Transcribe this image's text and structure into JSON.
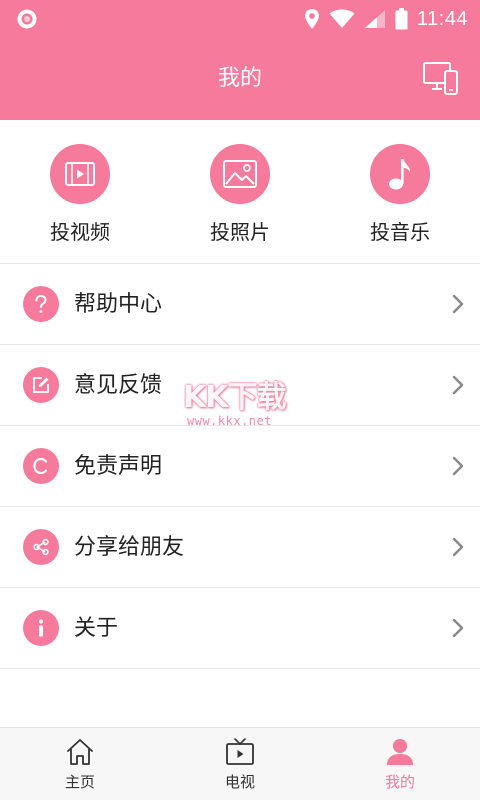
{
  "status_bar": {
    "time": "11:44",
    "icons": [
      "notification-circle-icon",
      "location-icon",
      "wifi-icon",
      "signal-icon",
      "battery-icon"
    ]
  },
  "header": {
    "title": "我的",
    "right_icon": "cast-screen-icon"
  },
  "quick_actions": [
    {
      "label": "投视频",
      "icon": "video-icon"
    },
    {
      "label": "投照片",
      "icon": "image-icon"
    },
    {
      "label": "投音乐",
      "icon": "music-note-icon"
    }
  ],
  "menu": [
    {
      "label": "帮助中心",
      "icon": "question-icon"
    },
    {
      "label": "意见反馈",
      "icon": "edit-icon"
    },
    {
      "label": "免责声明",
      "icon": "copyright-icon"
    },
    {
      "label": "分享给朋友",
      "icon": "share-icon"
    },
    {
      "label": "关于",
      "icon": "info-icon"
    }
  ],
  "watermark": {
    "text": "KK下载",
    "url": "www.kkx.net"
  },
  "bottom_nav": [
    {
      "label": "主页",
      "icon": "home-icon",
      "active": false
    },
    {
      "label": "电视",
      "icon": "tv-icon",
      "active": false
    },
    {
      "label": "我的",
      "icon": "person-icon",
      "active": true
    }
  ],
  "colors": {
    "accent": "#f57a9c",
    "text": "#222222",
    "divider": "#e6e6e6"
  }
}
